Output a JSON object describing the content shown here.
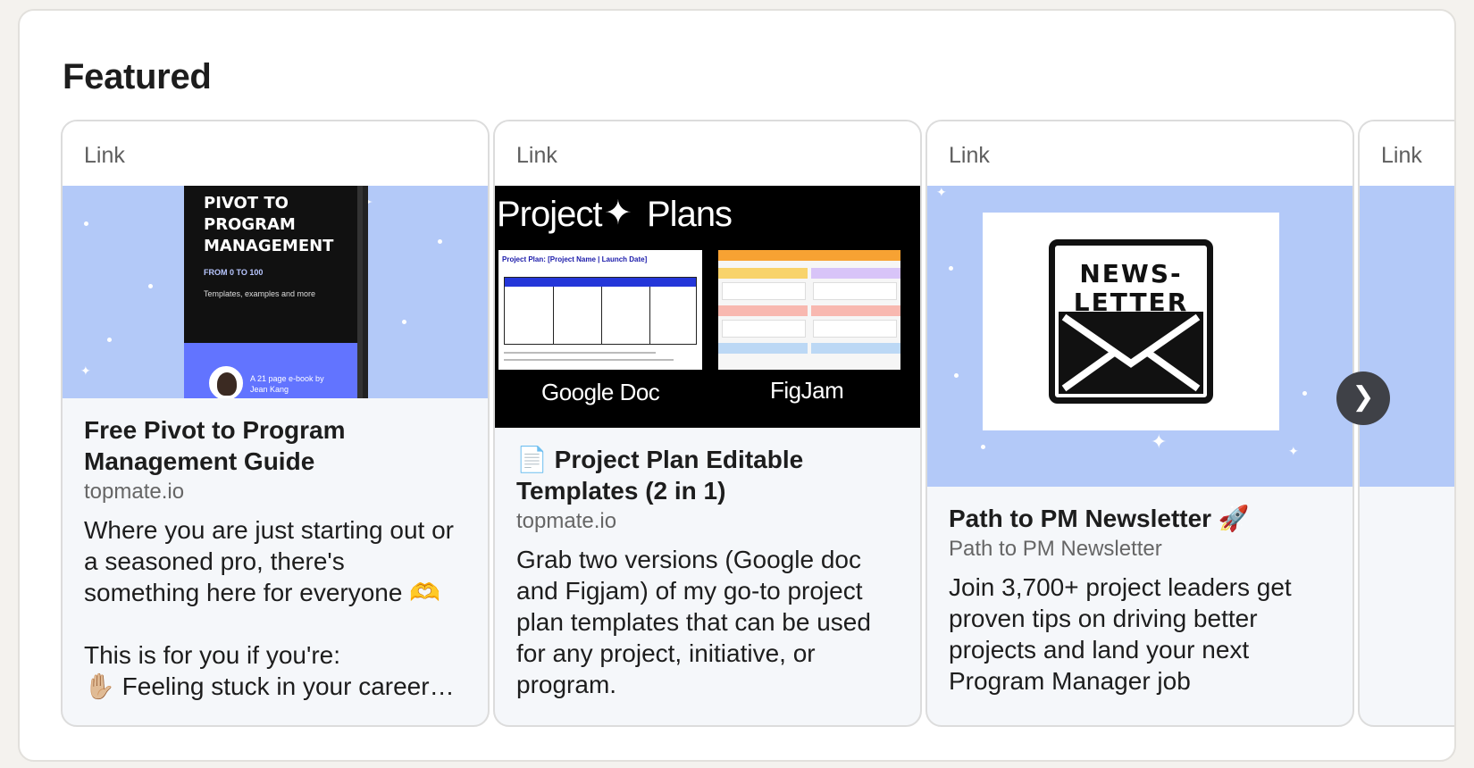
{
  "section": {
    "title": "Featured"
  },
  "cards": [
    {
      "type": "Link",
      "title": "Free Pivot to Program Management Guide",
      "source": "topmate.io",
      "description": "Where you are just starting out or a seasoned pro, there's something here for everyone 🫶\n\nThis is for you if you're:\n✋🏼 Feeling stuck in your career…",
      "media": {
        "book_title": "PIVOT TO\nPROGRAM\nMANAGEMENT",
        "book_subtitle": "FROM 0 TO 100",
        "book_desc": "Templates, examples and more",
        "book_author": "A 21 page e-book by\nJean Kang"
      }
    },
    {
      "type": "Link",
      "title": "📄 Project Plan Editable Templates (2 in 1)",
      "source": "topmate.io",
      "description": "Grab two versions (Google doc and Figjam) of my go-to project plan templates that can be used for any project, initiative, or program.",
      "media": {
        "heading_left": "Project",
        "heading_right": "Plans",
        "doc_title": "Project Plan: [Project Name | Launch Date]",
        "label_left": "Google Doc",
        "label_right": "FigJam"
      }
    },
    {
      "type": "Link",
      "title": "Path to PM Newsletter 🚀",
      "source": "Path to PM Newsletter",
      "description": "Join 3,700+ project leaders get proven tips on driving better projects and land your next Program Manager job",
      "media": {
        "icon_text": "NEWS-\nLETTER"
      }
    },
    {
      "type": "Link"
    }
  ],
  "controls": {
    "next_glyph": "❯"
  },
  "colors": {
    "media_blue": "#b3c9f8",
    "book_band": "#6274ff"
  }
}
